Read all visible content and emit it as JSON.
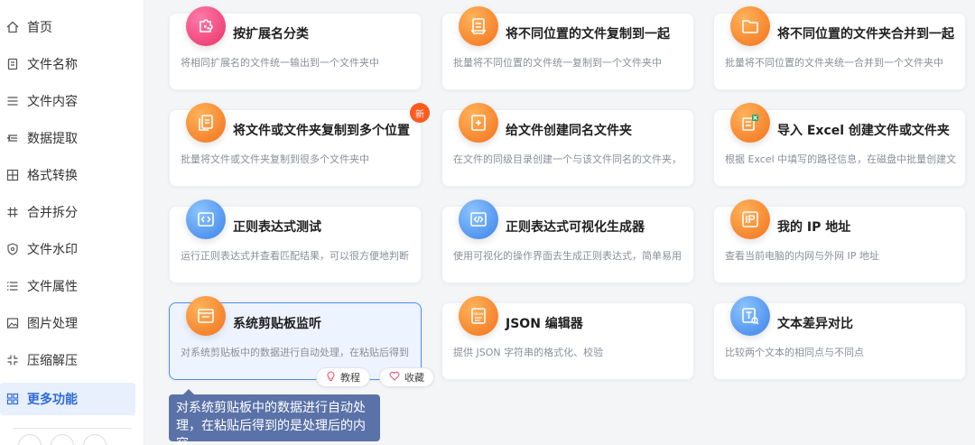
{
  "sidebar": {
    "items": [
      {
        "label": "首页",
        "icon": "home-icon"
      },
      {
        "label": "文件名称",
        "icon": "file-name-icon"
      },
      {
        "label": "文件内容",
        "icon": "file-content-icon"
      },
      {
        "label": "数据提取",
        "icon": "data-extract-icon"
      },
      {
        "label": "格式转换",
        "icon": "format-convert-icon"
      },
      {
        "label": "合并拆分",
        "icon": "merge-split-icon"
      },
      {
        "label": "文件水印",
        "icon": "watermark-icon"
      },
      {
        "label": "文件属性",
        "icon": "file-attributes-icon"
      },
      {
        "label": "图片处理",
        "icon": "image-icon"
      },
      {
        "label": "压缩解压",
        "icon": "compress-icon"
      },
      {
        "label": "更多功能",
        "icon": "more-apps-icon",
        "active": true
      }
    ]
  },
  "cards": [
    {
      "title": "按扩展名分类",
      "desc": "将相同扩展名的文件统一输出到一个文件夹中",
      "icon": "puzzle-icon",
      "color": "pink"
    },
    {
      "title": "将不同位置的文件复制到一起",
      "desc": "批量将不同位置的文件统一复制到一个文件夹中",
      "icon": "file-copy-icon",
      "color": "orange"
    },
    {
      "title": "将不同位置的文件夹合并到一起",
      "desc": "批量将不同位置的文件夹统一合并到一个文件夹中",
      "icon": "folder-icon",
      "color": "orange"
    },
    {
      "title": "将文件或文件夹复制到多个位置",
      "desc": "批量将文件或文件夹复制到很多个文件夹中",
      "icon": "multi-copy-icon",
      "color": "orange",
      "badge": "新"
    },
    {
      "title": "给文件创建同名文件夹",
      "desc": "在文件的同级目录创建一个与该文件同名的文件夹，",
      "icon": "folder-add-icon",
      "color": "orange"
    },
    {
      "title": "导入 Excel 创建文件或文件夹",
      "desc": "根据 Excel 中填写的路径信息，在磁盘中批量创建文",
      "icon": "excel-icon",
      "color": "orange"
    },
    {
      "title": "正则表达式测试",
      "desc": "运行正则表达式并查看匹配结果，可以很方便地判断",
      "icon": "code-icon",
      "color": "blue"
    },
    {
      "title": "正则表达式可视化生成器",
      "desc": "使用可视化的操作界面去生成正则表达式，简单易用",
      "icon": "code-window-icon",
      "color": "blue"
    },
    {
      "title": "我的 IP 地址",
      "desc": "查看当前电脑的内网与外网 IP 地址",
      "icon": "ip-icon",
      "color": "orange"
    },
    {
      "title": "系统剪贴板监听",
      "desc": "对系统剪贴板中的数据进行自动处理，在粘贴后得到",
      "icon": "clipboard-monitor-icon",
      "color": "orange",
      "highlight": true
    },
    {
      "title": "JSON 编辑器",
      "desc": "提供 JSON 字符串的格式化、校验",
      "icon": "json-icon",
      "color": "orange"
    },
    {
      "title": "文本差异对比",
      "desc": "比较两个文本的相同点与不同点",
      "icon": "text-diff-icon",
      "color": "blue"
    }
  ],
  "hover_actions": {
    "tutorial": "教程",
    "favorite": "收藏"
  },
  "tooltip": {
    "text": "对系统剪贴板中的数据进行自动处理，在粘贴后得到的是处理后的内容"
  }
}
